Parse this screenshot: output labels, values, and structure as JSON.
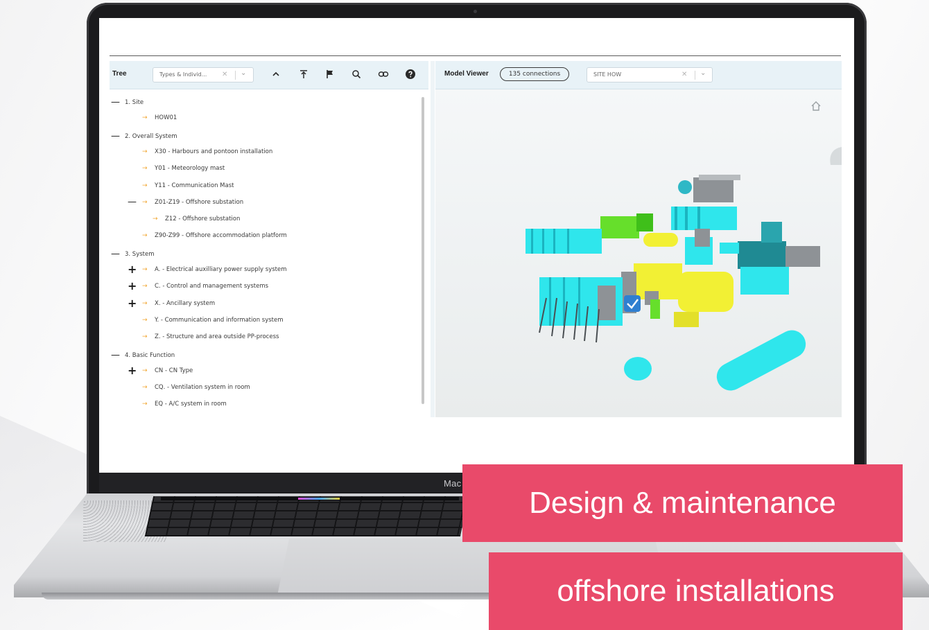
{
  "laptop": {
    "brand_label": "Mac"
  },
  "tree_panel": {
    "title": "Tree",
    "filter": {
      "value": "Types & Individ..."
    },
    "toolbar_icons": [
      "chevron-up-icon",
      "collapse-to-top-icon",
      "flag-icon",
      "search-icon",
      "link-icon",
      "help-icon"
    ],
    "rows": [
      {
        "label": "1. Site",
        "node": "minus",
        "arrow": false
      },
      {
        "label": "HOW01",
        "node": "",
        "arrow": true
      },
      {
        "label": "2. Overall System",
        "node": "minus",
        "arrow": false
      },
      {
        "label": "X30 - Harbours and pontoon installation",
        "node": "",
        "arrow": true
      },
      {
        "label": "Y01 - Meteorology mast",
        "node": "",
        "arrow": true
      },
      {
        "label": "Y11 - Communication Mast",
        "node": "",
        "arrow": true
      },
      {
        "label": "Z01-Z19 - Offshore substation",
        "node": "minus",
        "arrow": true
      },
      {
        "label": "Z12 - Offshore substation",
        "node": "",
        "arrow": true
      },
      {
        "label": "Z90-Z99 - Offshore accommodation platform",
        "node": "",
        "arrow": true
      },
      {
        "label": "3. System",
        "node": "minus",
        "arrow": false
      },
      {
        "label": "A. - Electrical auxilliary power supply system",
        "node": "plus",
        "arrow": true
      },
      {
        "label": "C. - Control and management systems",
        "node": "plus",
        "arrow": true
      },
      {
        "label": "X. - Ancillary system",
        "node": "plus",
        "arrow": true
      },
      {
        "label": "Y. - Communication and information system",
        "node": "",
        "arrow": true
      },
      {
        "label": "Z. - Structure and area outside PP-process",
        "node": "",
        "arrow": true
      },
      {
        "label": "4. Basic Function",
        "node": "minus",
        "arrow": false
      },
      {
        "label": "CN - CN Type",
        "node": "plus",
        "arrow": true
      },
      {
        "label": "CQ. - Ventilation system in room",
        "node": "",
        "arrow": true
      },
      {
        "label": "EQ - A/C system in room",
        "node": "",
        "arrow": true
      }
    ]
  },
  "model_viewer": {
    "title": "Model Viewer",
    "connections_badge": "135 connections",
    "site_filter": {
      "value": "SITE HOW"
    },
    "colors": {
      "cyan": "#2fe6ec",
      "yellow": "#f2f034",
      "green": "#66df2b",
      "teal": "#1f8a93",
      "grey": "#8e9296"
    }
  },
  "banners": {
    "line1": "Design & maintenance",
    "line2": "offshore installations",
    "color": "#e94a6a"
  }
}
